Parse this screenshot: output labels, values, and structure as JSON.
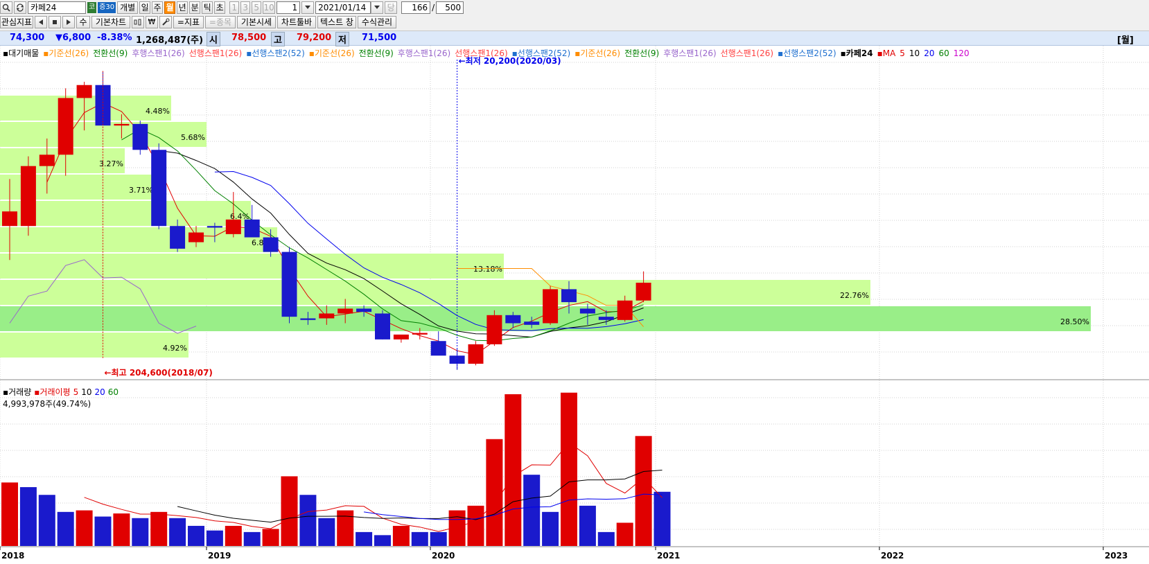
{
  "toolbar": {
    "stock_name": "카페24",
    "badges": [
      {
        "text": "코",
        "color": "#2e7d32"
      },
      {
        "text": "증30",
        "color": "#1565c0"
      }
    ],
    "period_buttons": [
      "개별",
      "일",
      "주",
      "월",
      "년",
      "분",
      "틱",
      "초"
    ],
    "selected_period": "월",
    "interval_buttons": [
      "1",
      "3",
      "5",
      "10"
    ],
    "interval_value": "1",
    "date": "2021/01/14",
    "date_prefix": "당",
    "count_value": "166",
    "count_sep": "/",
    "count_total": "500",
    "row2": {
      "watch_label": "관심지표",
      "su_label": "수",
      "basic_chart": "기본차트",
      "indicator": "=지표",
      "item": "=종목",
      "basic_quote": "기본시세",
      "chart_toolbar": "차트툴바",
      "text_label": "텍스트 창",
      "formula": "수식관리"
    }
  },
  "quote": {
    "price": "74,300",
    "change": "▼6,800",
    "change_pct": "-8.38%",
    "volume": "1,268,487(주)",
    "open_label": "시",
    "open": "78,500",
    "high_label": "고",
    "high": "79,200",
    "low_label": "저",
    "low": "71,500",
    "period_tag": "[월]"
  },
  "price_legend": [
    {
      "text": "▪대기매물",
      "color": "#000000"
    },
    {
      "text": "▪기준선(26)",
      "color": "#ff8c00"
    },
    {
      "text": "전환선(9)",
      "color": "#008000"
    },
    {
      "text": "후행스팬1(26)",
      "color": "#9966cc"
    },
    {
      "text": "선행스팬1(26)",
      "color": "#ff4040"
    },
    {
      "text": "▪선행스팬2(52)",
      "color": "#1e6fcf"
    },
    {
      "text": "▪기준선(26)",
      "color": "#ff8c00"
    },
    {
      "text": "전환선(9)",
      "color": "#008000"
    },
    {
      "text": "후행스팬1(26)",
      "color": "#9966cc"
    },
    {
      "text": "선행스팬1(26)",
      "color": "#ff4040"
    },
    {
      "text": "▪선행스팬2(52)",
      "color": "#1e6fcf"
    },
    {
      "text": "▪기준선(26)",
      "color": "#ff8c00"
    },
    {
      "text": "전환선(9)",
      "color": "#008000"
    },
    {
      "text": "후행스팬1(26)",
      "color": "#9966cc"
    },
    {
      "text": "선행스팬1(26)",
      "color": "#ff4040"
    },
    {
      "text": "▪선행스팬2(52)",
      "color": "#1e6fcf"
    },
    {
      "text": "▪카페24",
      "color": "#000000"
    },
    {
      "text": "▪MA",
      "color": "#e00000"
    },
    {
      "text": "5",
      "color": "#e00000"
    },
    {
      "text": "10",
      "color": "#000000"
    },
    {
      "text": "20",
      "color": "#0000ee"
    },
    {
      "text": "60",
      "color": "#008000"
    },
    {
      "text": "120",
      "color": "#cc00cc"
    }
  ],
  "volume_legend": [
    {
      "text": "▪거래량",
      "color": "#000000"
    },
    {
      "text": "▪거래이평",
      "color": "#e00000"
    },
    {
      "text": "5",
      "color": "#e00000"
    },
    {
      "text": "10",
      "color": "#000000"
    },
    {
      "text": "20",
      "color": "#0000ee"
    },
    {
      "text": "60",
      "color": "#008000"
    }
  ],
  "volume_info": "4,993,978주(49.74%)",
  "annotations": {
    "high": "←최고 204,600(2018/07)",
    "low": "←최저 20,200(2020/03)"
  },
  "band_labels": [
    "4.48%",
    "5.68%",
    "3.27%",
    "3.71%",
    "6.83%",
    "13.18%",
    "22.76%",
    "28.50%",
    "4.92%",
    "6.4%"
  ],
  "x_axis": [
    "2018",
    "2019",
    "2020",
    "2021",
    "2022",
    "2023"
  ],
  "colors": {
    "up": "#e00000",
    "down": "#1a1acc",
    "band": "#ccff99",
    "band_strong": "#99ee88"
  },
  "chart_data": {
    "type": "candlestick",
    "interval": "monthly",
    "candles": [
      {
        "o": 118,
        "h": 138,
        "l": 88,
        "c": 109,
        "dir": "up"
      },
      {
        "o": 109,
        "h": 152,
        "l": 103,
        "c": 146,
        "dir": "up"
      },
      {
        "o": 146,
        "h": 163,
        "l": 129,
        "c": 153,
        "dir": "up"
      },
      {
        "o": 153,
        "h": 194,
        "l": 140,
        "c": 188,
        "dir": "up"
      },
      {
        "o": 188,
        "h": 198,
        "l": 168,
        "c": 196,
        "dir": "up"
      },
      {
        "o": 196,
        "h": 204.6,
        "l": 175,
        "c": 171,
        "dir": "down"
      },
      {
        "o": 171,
        "h": 178,
        "l": 163,
        "c": 172,
        "dir": "up"
      },
      {
        "o": 172,
        "h": 174,
        "l": 153,
        "c": 156,
        "dir": "down"
      },
      {
        "o": 156,
        "h": 160,
        "l": 107,
        "c": 109,
        "dir": "down"
      },
      {
        "o": 109,
        "h": 113,
        "l": 93,
        "c": 95,
        "dir": "down"
      },
      {
        "o": 99,
        "h": 109,
        "l": 96,
        "c": 105,
        "dir": "up"
      },
      {
        "o": 109,
        "h": 111,
        "l": 99,
        "c": 108,
        "dir": "down"
      },
      {
        "o": 104,
        "h": 130,
        "l": 102,
        "c": 113,
        "dir": "up"
      },
      {
        "o": 113,
        "h": 122,
        "l": 104,
        "c": 102,
        "dir": "down"
      },
      {
        "o": 102,
        "h": 107,
        "l": 90,
        "c": 93,
        "dir": "down"
      },
      {
        "o": 93,
        "h": 96,
        "l": 49,
        "c": 53,
        "dir": "down"
      },
      {
        "o": 52,
        "h": 56,
        "l": 48,
        "c": 51,
        "dir": "down"
      },
      {
        "o": 52,
        "h": 60,
        "l": 48,
        "c": 55,
        "dir": "up"
      },
      {
        "o": 55,
        "h": 64,
        "l": 49,
        "c": 58,
        "dir": "up"
      },
      {
        "o": 58,
        "h": 60,
        "l": 53,
        "c": 56,
        "dir": "down"
      },
      {
        "o": 55,
        "h": 57,
        "l": 39,
        "c": 39,
        "dir": "down"
      },
      {
        "o": 39,
        "h": 41,
        "l": 37,
        "c": 42,
        "dir": "up"
      },
      {
        "o": 42,
        "h": 46,
        "l": 39,
        "c": 43,
        "dir": "up"
      },
      {
        "o": 38,
        "h": 44,
        "l": 36,
        "c": 29,
        "dir": "down"
      },
      {
        "o": 29,
        "h": 33,
        "l": 20.2,
        "c": 24,
        "dir": "down"
      },
      {
        "o": 24,
        "h": 38,
        "l": 23,
        "c": 36,
        "dir": "up"
      },
      {
        "o": 36,
        "h": 57,
        "l": 35,
        "c": 54,
        "dir": "up"
      },
      {
        "o": 54,
        "h": 56,
        "l": 46,
        "c": 49,
        "dir": "down"
      },
      {
        "o": 50,
        "h": 53,
        "l": 46,
        "c": 48,
        "dir": "down"
      },
      {
        "o": 49,
        "h": 72,
        "l": 48,
        "c": 70,
        "dir": "up"
      },
      {
        "o": 70,
        "h": 75,
        "l": 55,
        "c": 62,
        "dir": "down"
      },
      {
        "o": 58,
        "h": 61,
        "l": 48,
        "c": 55,
        "dir": "down"
      },
      {
        "o": 53,
        "h": 57,
        "l": 48,
        "c": 51,
        "dir": "down"
      },
      {
        "o": 51,
        "h": 66,
        "l": 50,
        "c": 63,
        "dir": "up"
      },
      {
        "o": 63,
        "h": 81,
        "l": 62,
        "c": 74,
        "dir": "up"
      }
    ],
    "volume": [
      {
        "v": 4.1,
        "dir": "up"
      },
      {
        "v": 3.8,
        "dir": "down"
      },
      {
        "v": 3.3,
        "dir": "down"
      },
      {
        "v": 2.2,
        "dir": "down"
      },
      {
        "v": 2.3,
        "dir": "up"
      },
      {
        "v": 1.9,
        "dir": "down"
      },
      {
        "v": 2.1,
        "dir": "up"
      },
      {
        "v": 1.8,
        "dir": "down"
      },
      {
        "v": 2.2,
        "dir": "up"
      },
      {
        "v": 1.8,
        "dir": "down"
      },
      {
        "v": 1.3,
        "dir": "down"
      },
      {
        "v": 1.0,
        "dir": "down"
      },
      {
        "v": 1.3,
        "dir": "up"
      },
      {
        "v": 0.9,
        "dir": "down"
      },
      {
        "v": 1.1,
        "dir": "up"
      },
      {
        "v": 4.5,
        "dir": "up"
      },
      {
        "v": 3.3,
        "dir": "down"
      },
      {
        "v": 1.8,
        "dir": "down"
      },
      {
        "v": 2.3,
        "dir": "up"
      },
      {
        "v": 0.9,
        "dir": "down"
      },
      {
        "v": 0.7,
        "dir": "down"
      },
      {
        "v": 1.3,
        "dir": "up"
      },
      {
        "v": 0.9,
        "dir": "down"
      },
      {
        "v": 0.9,
        "dir": "down"
      },
      {
        "v": 2.3,
        "dir": "up"
      },
      {
        "v": 2.6,
        "dir": "up"
      },
      {
        "v": 6.9,
        "dir": "up"
      },
      {
        "v": 9.8,
        "dir": "up"
      },
      {
        "v": 4.6,
        "dir": "down"
      },
      {
        "v": 2.2,
        "dir": "down"
      },
      {
        "v": 9.9,
        "dir": "up"
      },
      {
        "v": 2.6,
        "dir": "down"
      },
      {
        "v": 0.9,
        "dir": "down"
      },
      {
        "v": 1.5,
        "dir": "up"
      },
      {
        "v": 7.1,
        "dir": "up"
      },
      {
        "v": 3.5,
        "dir": "down"
      }
    ]
  }
}
